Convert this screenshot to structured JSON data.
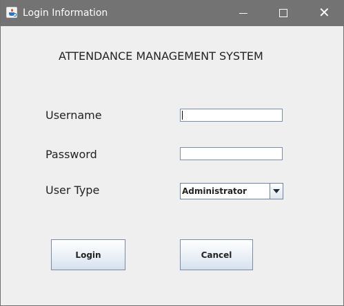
{
  "window": {
    "title": "Login Information",
    "icon": "java-app-icon"
  },
  "form": {
    "heading": "ATTENDANCE MANAGEMENT SYSTEM",
    "username_label": "Username",
    "password_label": "Password",
    "user_type_label": "User Type",
    "username_value": "",
    "password_value": "",
    "user_type_selected": "Administrator"
  },
  "buttons": {
    "login": "Login",
    "cancel": "Cancel"
  },
  "colors": {
    "titlebar": "#737373",
    "window_bg": "#efefef",
    "field_border": "#7a8da6"
  }
}
